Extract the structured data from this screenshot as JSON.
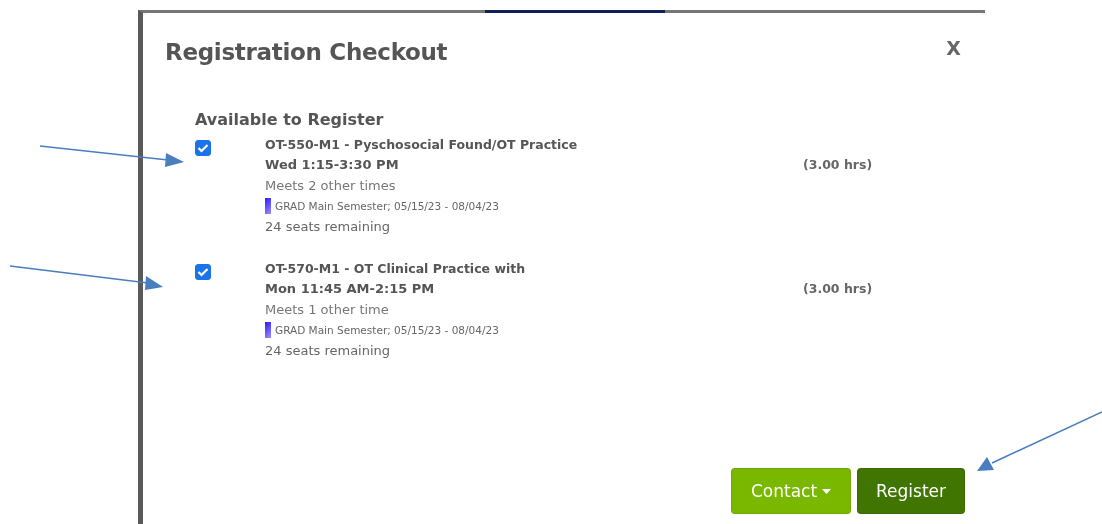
{
  "dialog": {
    "title": "Registration Checkout",
    "close": "X"
  },
  "section": {
    "heading": "Available to Register"
  },
  "courses": [
    {
      "title": "OT-550-M1 - Pyschosocial Found/OT Practice",
      "time": "Wed 1:15-3:30 PM",
      "meets": "Meets 2 other times",
      "term": "GRAD Main Semester; 05/15/23 - 08/04/23",
      "seats": "24 seats remaining",
      "hours": "(3.00 hrs)",
      "checked": true
    },
    {
      "title": "OT-570-M1 - OT Clinical Practice with",
      "time": "Mon 11:45 AM-2:15 PM",
      "meets": "Meets 1 other time",
      "term": "GRAD Main Semester; 05/15/23 - 08/04/23",
      "seats": "24 seats remaining",
      "hours": "(3.00 hrs)",
      "checked": true
    }
  ],
  "buttons": [
    {
      "label": "Contact",
      "kind": "dropdown"
    },
    {
      "label": "Register",
      "kind": "primary"
    }
  ]
}
